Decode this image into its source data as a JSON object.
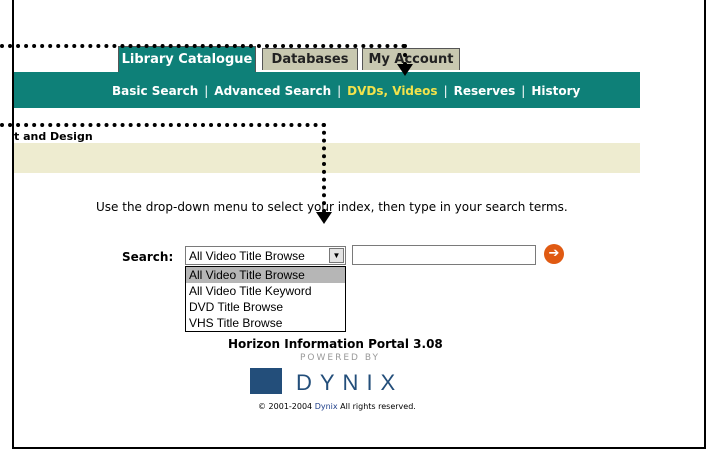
{
  "tabs": [
    "Library Catalogue",
    "Databases",
    "My Account"
  ],
  "subnav": {
    "items": [
      "Basic Search",
      "Advanced Search",
      "DVDs, Videos",
      "Reserves",
      "History"
    ],
    "separator": "|",
    "current": "DVDs, Videos"
  },
  "section_title": "t and Design",
  "instructions": "Use the drop-down menu to select your index, then type in your search terms.",
  "search": {
    "label": "Search:",
    "selected": "All Video Title Browse",
    "options": [
      "All Video Title Browse",
      "All Video Title Keyword",
      "DVD Title Browse",
      "VHS Title Browse"
    ],
    "input_value": ""
  },
  "footer": {
    "portal": "Horizon Information Portal 3.08",
    "powered_by": "POWERED BY",
    "brand": "DYNIX",
    "copyright_pre": "© 2001-2004",
    "copyright_link": "Dynix",
    "copyright_post": "All rights reserved."
  },
  "colors": {
    "nav_teal": "#0e8078",
    "current_link": "#f2e24c",
    "beige": "#eeecd0",
    "go_button": "#e05a12",
    "brand_blue": "#234e7a"
  }
}
